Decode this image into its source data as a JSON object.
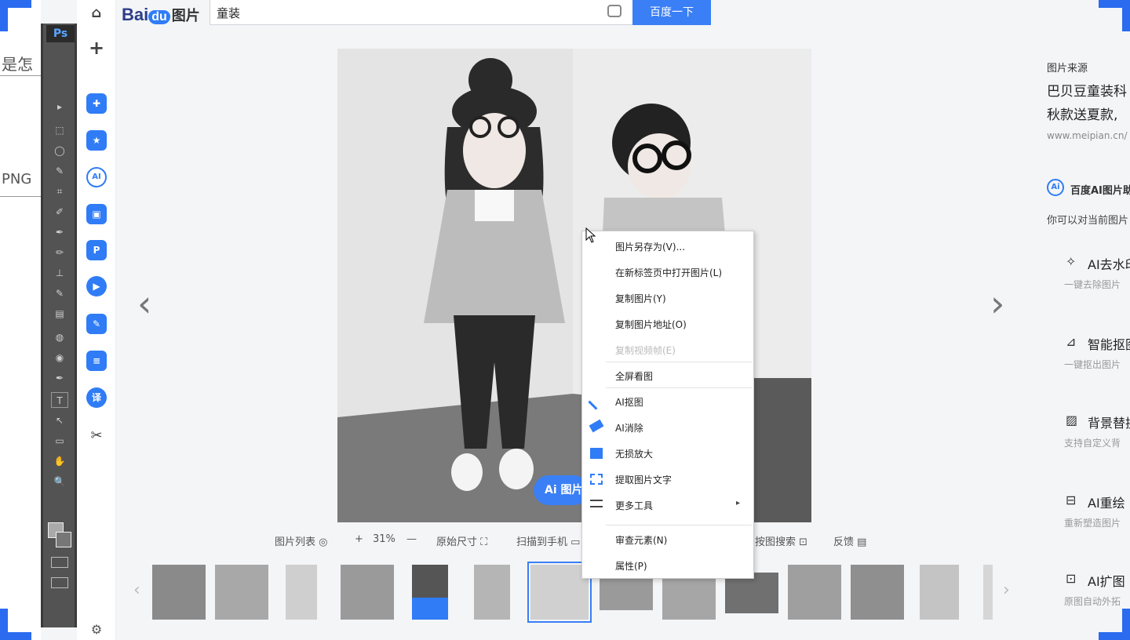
{
  "doc_fragment": {
    "line1": "是怎",
    "line2": "PNG"
  },
  "ps_toolbar": {
    "logo": "Ps",
    "tools": [
      "▸",
      "⬚",
      "◯",
      "✎",
      "⌗",
      "✐",
      "✒",
      "✏",
      "⊥",
      "✎",
      "▤",
      "◍",
      "◉",
      "✒",
      "T",
      "↖",
      "▭",
      "✋",
      "🔍",
      "⬛"
    ]
  },
  "sidenav": {
    "items": [
      {
        "icon": "home-icon",
        "glyph": "⌂"
      },
      {
        "icon": "plus-icon",
        "glyph": "+"
      },
      {
        "icon": "puzzle-icon",
        "glyph": "✚"
      },
      {
        "icon": "star-icon",
        "glyph": "★"
      },
      {
        "icon": "ai-icon",
        "glyph": "AI"
      },
      {
        "icon": "ai-image-icon",
        "glyph": "▣"
      },
      {
        "icon": "ai-pdf-icon",
        "glyph": "P"
      },
      {
        "icon": "ai-video-icon",
        "glyph": "▶"
      },
      {
        "icon": "ai-edit-icon",
        "glyph": "✎"
      },
      {
        "icon": "ai-doc-icon",
        "glyph": "≡"
      },
      {
        "icon": "translate-icon",
        "glyph": "译"
      },
      {
        "icon": "scissors-icon",
        "glyph": "✂"
      },
      {
        "icon": "settings-icon",
        "glyph": "⚙"
      }
    ]
  },
  "header": {
    "logo_text": "Bai",
    "logo_paw": "du",
    "logo_suffix": "图片",
    "search_value": "童装",
    "search_button": "百度一下"
  },
  "viewer": {
    "prev_glyph": "‹",
    "next_glyph": "›",
    "ai_pill": "Ai 图片"
  },
  "bottom_bar": {
    "list": "图片列表 ◎",
    "zoom_in": "+",
    "zoom": "31%",
    "zoom_out": "—",
    "original_size": "原始尺寸 ⛶",
    "scan": "扫描到手机 ▭",
    "search_by_image": "按图搜索 ⊡",
    "feedback": "反馈 ▤"
  },
  "context_menu": {
    "items": [
      {
        "label": "图片另存为(V)...",
        "disabled": false
      },
      {
        "label": "在新标签页中打开图片(L)",
        "disabled": false
      },
      {
        "label": "复制图片(Y)",
        "disabled": false
      },
      {
        "label": "复制图片地址(O)",
        "disabled": false
      },
      {
        "label": "复制视频帧(E)",
        "disabled": true
      },
      {
        "label": "全屏看图",
        "disabled": false
      },
      {
        "label": "AI抠图",
        "disabled": false
      },
      {
        "label": "AI消除",
        "disabled": false
      },
      {
        "label": "无损放大",
        "disabled": false
      },
      {
        "label": "提取图片文字",
        "disabled": false
      },
      {
        "label": "更多工具",
        "disabled": false
      },
      {
        "label": "审查元素(N)",
        "disabled": false
      },
      {
        "label": "属性(P)",
        "disabled": false
      }
    ],
    "submenu_arrow": "▸"
  },
  "right_panel": {
    "source_label": "图片来源",
    "source_title_1": "巴贝豆童装科",
    "source_title_2": "秋款送夏款,",
    "source_url": "www.meipian.cn/",
    "ai_badge": "Ai",
    "ai_title": "百度AI图片助",
    "ai_desc": "你可以对当前图片",
    "tools": [
      {
        "name": "AI去水印",
        "desc": "一键去除图片",
        "glyph": "✧"
      },
      {
        "name": "智能抠图",
        "desc": "一键抠出图片",
        "glyph": "⊿"
      },
      {
        "name": "背景替换",
        "desc": "支持自定义背",
        "glyph": "▨"
      },
      {
        "name": "AI重绘 ",
        "desc": "重新塑造图片",
        "glyph": "⊟"
      },
      {
        "name": "AI扩图 ",
        "desc": "原图自动外拓",
        "glyph": "⊡"
      }
    ]
  }
}
